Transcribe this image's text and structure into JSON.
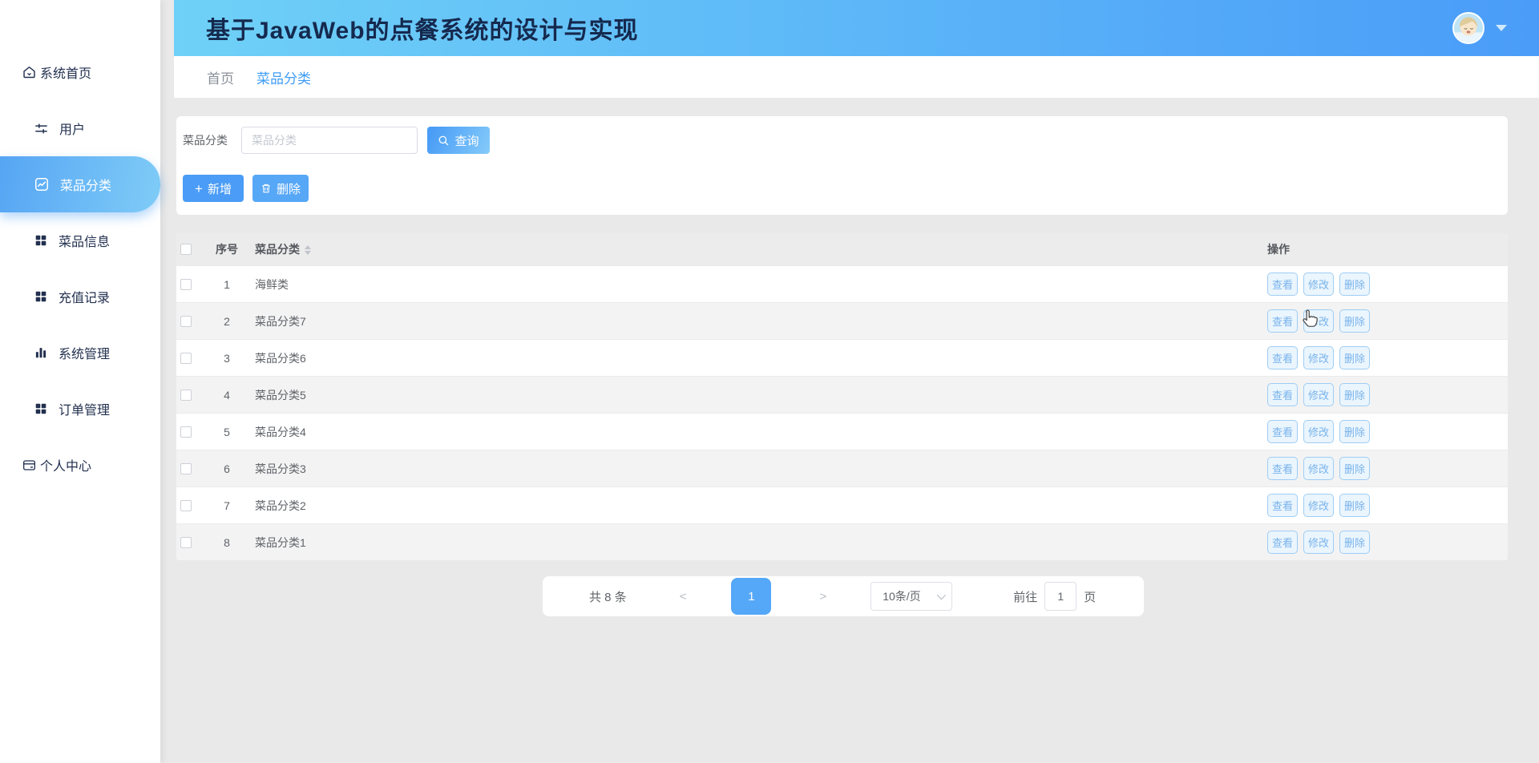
{
  "header": {
    "title": "基于JavaWeb的点餐系统的设计与实现",
    "avatar_alt": "user-avatar"
  },
  "sidebar": {
    "items": [
      {
        "key": "system-home",
        "label": "系统首页",
        "icon": "home-icon",
        "active": false,
        "compact": true
      },
      {
        "key": "users",
        "label": "用户",
        "icon": "sliders-icon",
        "active": false,
        "compact": false
      },
      {
        "key": "dish-category",
        "label": "菜品分类",
        "icon": "trend-icon",
        "active": true,
        "compact": false
      },
      {
        "key": "dish-info",
        "label": "菜品信息",
        "icon": "grid-icon",
        "active": false,
        "compact": false
      },
      {
        "key": "recharge-log",
        "label": "充值记录",
        "icon": "grid-icon",
        "active": false,
        "compact": false
      },
      {
        "key": "system-manage",
        "label": "系统管理",
        "icon": "bar-chart-icon",
        "active": false,
        "compact": false
      },
      {
        "key": "order-manage",
        "label": "订单管理",
        "icon": "grid-icon",
        "active": false,
        "compact": false
      },
      {
        "key": "personal-center",
        "label": "个人中心",
        "icon": "card-icon",
        "active": false,
        "compact": true
      }
    ]
  },
  "tabs": [
    {
      "key": "home",
      "label": "首页",
      "active": false
    },
    {
      "key": "dish-category",
      "label": "菜品分类",
      "active": true
    }
  ],
  "search": {
    "label": "菜品分类",
    "placeholder": "菜品分类",
    "query_label": "查询"
  },
  "toolbar": {
    "add_label": "新增",
    "delete_label": "删除"
  },
  "table": {
    "columns": {
      "index": "序号",
      "category": "菜品分类",
      "ops": "操作"
    },
    "action_labels": [
      "查看",
      "修改",
      "删除"
    ],
    "rows": [
      {
        "index": "1",
        "category": "海鲜类"
      },
      {
        "index": "2",
        "category": "菜品分类7"
      },
      {
        "index": "3",
        "category": "菜品分类6"
      },
      {
        "index": "4",
        "category": "菜品分类5"
      },
      {
        "index": "5",
        "category": "菜品分类4"
      },
      {
        "index": "6",
        "category": "菜品分类3"
      },
      {
        "index": "7",
        "category": "菜品分类2"
      },
      {
        "index": "8",
        "category": "菜品分类1"
      }
    ]
  },
  "pagination": {
    "total_label": "共 8 条",
    "prev_label": "<",
    "current_page": "1",
    "next_label": ">",
    "page_size_label": "10条/页",
    "goto_label": "前往",
    "goto_value": "1",
    "page_suffix_label": "页"
  },
  "colors": {
    "accent": "#409eff",
    "header_gradient_left": "#6fd1f7",
    "header_gradient_right": "#4a9cf8",
    "active_menu_gradient": "#56a5f4 → #7fccf7",
    "page_background": "#e9e9e9",
    "pager_active": "#55a7f7"
  }
}
